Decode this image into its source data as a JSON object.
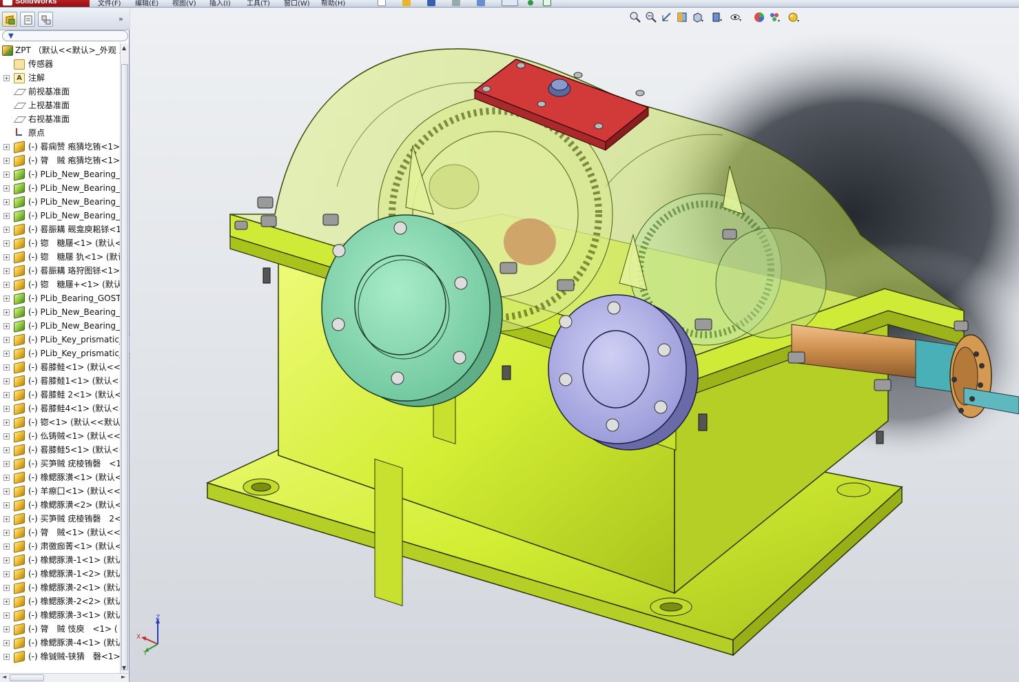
{
  "app": {
    "logo": "SolidWorks",
    "colors": {
      "body_green": "#d8f23c",
      "cover_red": "#c0392b",
      "flange_green": "#8fdcb6",
      "flange_violet": "#b7b7e8",
      "viewport_bg": "#e3e6ea"
    }
  },
  "menubar": {
    "items": [
      "文件(F)",
      "编辑(E)",
      "视图(V)",
      "插入(I)",
      "工具(T)",
      "窗口(W)",
      "帮助(H)"
    ]
  },
  "panel": {
    "tabs": [
      "feature-manager-icon",
      "property-manager-icon",
      "configuration-manager-icon"
    ],
    "expand_glyph": "»",
    "filter_glyph": "▼"
  },
  "tree": {
    "root": {
      "label": "ZPT （默认<<默认>_外观 显",
      "icon": "assembly-icon"
    },
    "items": [
      {
        "label": "传感器",
        "icon": "sensor-icon",
        "expandable": false
      },
      {
        "label": "注解",
        "icon": "annotation-icon",
        "expandable": true
      },
      {
        "label": "前视基准面",
        "icon": "plane-icon",
        "expandable": false
      },
      {
        "label": "上视基准面",
        "icon": "plane-icon",
        "expandable": false
      },
      {
        "label": "右视基准面",
        "icon": "plane-icon",
        "expandable": false
      },
      {
        "label": "原点",
        "icon": "origin-icon",
        "expandable": false
      },
      {
        "label": "(-) 晷痫赞 疱猜圪铕<1>",
        "icon": "part-icon",
        "expandable": true
      },
      {
        "label": "(-) 膂　贼 疱猜圪铕<1>",
        "icon": "part-icon",
        "expandable": true
      },
      {
        "label": "(-) PLib_New_Bearing_(",
        "icon": "library-part-icon",
        "expandable": true
      },
      {
        "label": "(-) PLib_New_Bearing_(",
        "icon": "library-part-icon",
        "expandable": true
      },
      {
        "label": "(-) PLib_New_Bearing_(",
        "icon": "library-part-icon",
        "expandable": true
      },
      {
        "label": "(-) PLib_New_Bearing_(",
        "icon": "library-part-icon",
        "expandable": true
      },
      {
        "label": "(-) 晷脤耩 觋龛庾耜铩<1",
        "icon": "part-icon",
        "expandable": true
      },
      {
        "label": "(-) 锪　糖屦<1> (默认<",
        "icon": "part-icon",
        "expandable": true
      },
      {
        "label": "(-) 锪　糖屦 犰<1> (默认",
        "icon": "part-icon",
        "expandable": true
      },
      {
        "label": "(-) 晷脤耩 珞狩图铩<1>",
        "icon": "part-icon",
        "expandable": true
      },
      {
        "label": "(-) 锪　糖屦+<1> (默认",
        "icon": "part-icon",
        "expandable": true
      },
      {
        "label": "(-) PLib_Bearing_GOST_",
        "icon": "library-part-icon",
        "expandable": true
      },
      {
        "label": "(-) PLib_New_Bearing_(",
        "icon": "library-part-icon",
        "expandable": true
      },
      {
        "label": "(-) PLib_New_Bearing_(",
        "icon": "library-part-icon",
        "expandable": true
      },
      {
        "label": "(-) PLib_Key_prismatic_",
        "icon": "part-icon",
        "expandable": true
      },
      {
        "label": "(-) PLib_Key_prismatic_",
        "icon": "part-icon",
        "expandable": true
      },
      {
        "label": "(-) 晷膝鲑<1> (默认<<默",
        "icon": "part-icon",
        "expandable": true
      },
      {
        "label": "(-) 晷膝鲑1<1> (默认<<",
        "icon": "part-icon",
        "expandable": true
      },
      {
        "label": "(-) 晷膝鲑 2<1> (默认<",
        "icon": "part-icon",
        "expandable": true
      },
      {
        "label": "(-) 晷膝鲑4<1> (默认<<",
        "icon": "part-icon",
        "expandable": true
      },
      {
        "label": "(-) 锪<1> (默认<<默认_",
        "icon": "part-icon",
        "expandable": true
      },
      {
        "label": "(-) 仫铸贼<1> (默认<<默",
        "icon": "part-icon",
        "expandable": true
      },
      {
        "label": "(-) 晷膝鲑5<1> (默认<<",
        "icon": "part-icon",
        "expandable": true
      },
      {
        "label": "(-) 买笋贼 疣棱铕磬　<1",
        "icon": "part-icon",
        "expandable": true
      },
      {
        "label": "(-) 橡鳃豚潢<1> (默认<",
        "icon": "part-icon",
        "expandable": true
      },
      {
        "label": "(-) 羊瘵囗<1> (默认<<默",
        "icon": "part-icon",
        "expandable": true
      },
      {
        "label": "(-) 橡鳃豚潢<2> (默认<",
        "icon": "part-icon",
        "expandable": true
      },
      {
        "label": "(-) 买笋贼 疣棱铕磬　2<",
        "icon": "part-icon",
        "expandable": true
      },
      {
        "label": "(-) 膂　贼<1> (默认<<默",
        "icon": "part-icon",
        "expandable": true
      },
      {
        "label": "(-) 肃徼痂菁<1> (默认<",
        "icon": "part-icon",
        "expandable": true
      },
      {
        "label": "(-) 橡鳃豚潢-1<1> (默认",
        "icon": "part-icon",
        "expandable": true
      },
      {
        "label": "(-) 橡鳃豚潢-1<2> (默认",
        "icon": "part-icon",
        "expandable": true
      },
      {
        "label": "(-) 橡鳃豚潢-2<1> (默认",
        "icon": "part-icon",
        "expandable": true
      },
      {
        "label": "(-) 橡鳃豚潢-2<2> (默认",
        "icon": "part-icon",
        "expandable": true
      },
      {
        "label": "(-) 橡鳃豚潢-3<1> (默认",
        "icon": "part-icon",
        "expandable": true
      },
      {
        "label": "(-) 膂　贼 忮庾　<1> (",
        "icon": "part-icon",
        "expandable": true
      },
      {
        "label": "(-) 橡鳃豚潢-4<1> (默认",
        "icon": "part-icon",
        "expandable": true
      },
      {
        "label": "(-) 橡铖贼-铗猜　磬<1>",
        "icon": "part-icon",
        "expandable": true
      }
    ]
  },
  "viewport": {
    "headsup_icons": [
      "zoom-to-fit-icon",
      "zoom-to-area-icon",
      "previous-view-icon",
      "section-view-icon",
      "view-orientation-icon",
      "display-style-icon",
      "hide-show-items-icon",
      "edit-appearance-icon",
      "apply-scene-icon",
      "view-settings-icon"
    ],
    "triad": {
      "x": "X",
      "y": "Y",
      "z": "Z"
    }
  }
}
